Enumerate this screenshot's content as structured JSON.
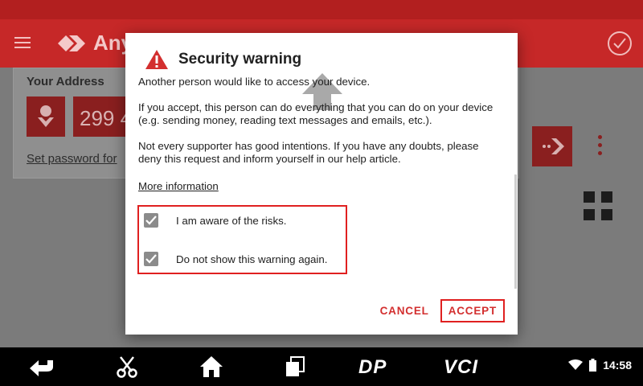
{
  "app": {
    "name": "Any",
    "address_label": "Your Address",
    "id_partial": "299 4",
    "set_password_link": "Set password for"
  },
  "dialog": {
    "title": "Security warning",
    "icon": "warning-triangle-icon",
    "paragraphs": [
      "Another person would like to access your device.",
      "If you accept, this person can do everything that you can do on your device (e.g. sending money, reading text messages and emails, etc.).",
      "Not every supporter has good intentions. If you have any doubts, please deny this request and inform yourself in our help article."
    ],
    "more_info": "More information",
    "checkboxes": [
      {
        "label": "I am aware of the risks.",
        "checked": true
      },
      {
        "label": "Do not show this warning again.",
        "checked": true
      }
    ],
    "cancel": "CANCEL",
    "accept": "ACCEPT"
  },
  "navbar": {
    "dp_label": "DP",
    "vci_label": "VCI",
    "time": "14:58"
  },
  "colors": {
    "accent": "#d32f2f",
    "appbar": "#c62828",
    "highlight": "#e02020"
  }
}
